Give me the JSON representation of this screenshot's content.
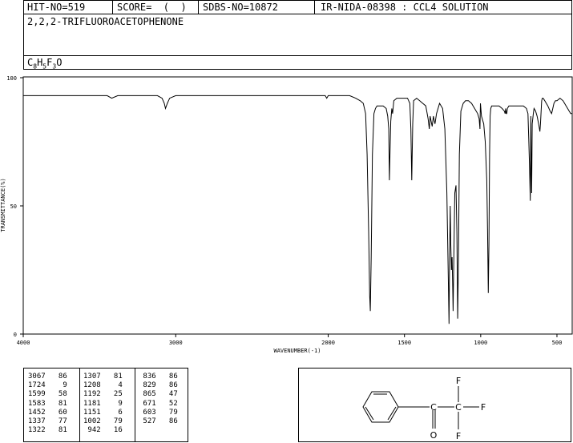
{
  "header": {
    "hit_no": "HIT-NO=519",
    "score": "SCORE=  (  )",
    "sdbs_no": "SDBS-NO=10872",
    "ir_info": "IR-NIDA-08398 : CCL4 SOLUTION",
    "compound_name": "2,2,2-TRIFLUOROACETOPHENONE",
    "formula": {
      "c": "C",
      "c_n": "8",
      "h": "H",
      "h_n": "5",
      "f": "F",
      "f_n": "3",
      "o": "O"
    }
  },
  "chart_data": {
    "type": "line",
    "title": "",
    "xlabel": "WAVENUMBER(-1)",
    "ylabel": "TRANSMITTANCE(%)",
    "xlim": [
      4000,
      400
    ],
    "ylim": [
      0,
      100
    ],
    "x_ticks": [
      {
        "value": 4000,
        "label": "4000"
      },
      {
        "value": 3000,
        "label": "3000"
      },
      {
        "value": 2000,
        "label": "2000"
      },
      {
        "value": 1500,
        "label": "1500"
      },
      {
        "value": 1000,
        "label": "1000"
      },
      {
        "value": 500,
        "label": "500"
      }
    ],
    "y_ticks": [
      {
        "value": 0,
        "label": "0"
      },
      {
        "value": 50,
        "label": "50"
      },
      {
        "value": 100,
        "label": "100"
      }
    ],
    "series": [
      {
        "x": [
          4000,
          3800,
          3600,
          3450,
          3420,
          3380,
          3300,
          3200,
          3120,
          3090,
          3075,
          3067,
          3055,
          3040,
          3000,
          2800,
          2500,
          2200,
          2020,
          2010,
          2000,
          1980,
          1950,
          1900,
          1860,
          1820,
          1790,
          1770,
          1755,
          1745,
          1735,
          1728,
          1724,
          1718,
          1710,
          1700,
          1690,
          1680,
          1660,
          1640,
          1620,
          1610,
          1603,
          1599,
          1595,
          1590,
          1583,
          1578,
          1570,
          1550,
          1530,
          1500,
          1480,
          1465,
          1458,
          1452,
          1446,
          1440,
          1420,
          1400,
          1380,
          1360,
          1345,
          1337,
          1332,
          1322,
          1318,
          1310,
          1307,
          1300,
          1290,
          1270,
          1250,
          1235,
          1222,
          1212,
          1208,
          1204,
          1200,
          1196,
          1192,
          1188,
          1184,
          1181,
          1176,
          1170,
          1162,
          1156,
          1151,
          1146,
          1140,
          1130,
          1115,
          1100,
          1080,
          1060,
          1040,
          1020,
          1010,
          1005,
          1002,
          999,
          995,
          980,
          970,
          960,
          955,
          950,
          946,
          942,
          938,
          934,
          928,
          920,
          900,
          880,
          860,
          845,
          840,
          836,
          832,
          829,
          825,
          815,
          800,
          780,
          760,
          740,
          720,
          700,
          690,
          685,
          680,
          675,
          673,
          671,
          669,
          666,
          662,
          655,
          650,
          640,
          630,
          620,
          612,
          608,
          603,
          600,
          596,
          590,
          580,
          560,
          545,
          535,
          527,
          520,
          510,
          500,
          480,
          460,
          440,
          420,
          410,
          400
        ],
        "values": [
          93,
          93,
          93,
          93,
          92,
          93,
          93,
          93,
          93,
          92,
          90,
          88,
          90,
          92,
          93,
          93,
          93,
          93,
          93,
          92,
          93,
          93,
          93,
          93,
          93,
          92,
          91,
          90,
          86,
          70,
          40,
          15,
          9,
          30,
          70,
          86,
          88,
          89,
          89,
          89,
          88,
          85,
          80,
          60,
          70,
          83,
          88,
          86,
          91,
          92,
          92,
          92,
          92,
          90,
          80,
          60,
          82,
          91,
          92,
          91,
          90,
          89,
          84,
          80,
          85,
          82,
          81,
          85,
          84,
          82,
          86,
          90,
          88,
          80,
          55,
          20,
          4,
          30,
          50,
          35,
          25,
          30,
          20,
          9,
          30,
          55,
          58,
          40,
          6,
          30,
          70,
          87,
          90,
          91,
          91,
          90,
          88,
          86,
          84,
          80,
          90,
          88,
          85,
          82,
          75,
          60,
          40,
          16,
          35,
          70,
          85,
          88,
          89,
          89,
          89,
          89,
          88,
          87,
          86,
          88,
          86,
          86,
          88,
          89,
          89,
          89,
          89,
          89,
          89,
          88,
          86,
          76,
          66,
          52,
          68,
          85,
          70,
          55,
          82,
          86,
          88,
          87,
          85,
          82,
          79,
          82,
          88,
          91,
          92,
          92,
          91,
          89,
          87,
          86,
          88,
          90,
          91,
          91,
          92,
          91,
          89,
          87,
          86,
          86
        ]
      }
    ],
    "peak_table": [
      [
        [
          3067,
          86
        ],
        [
          1724,
          9
        ],
        [
          1599,
          58
        ],
        [
          1583,
          81
        ],
        [
          1452,
          60
        ],
        [
          1337,
          77
        ],
        [
          1322,
          81
        ]
      ],
      [
        [
          1307,
          81
        ],
        [
          1208,
          4
        ],
        [
          1192,
          25
        ],
        [
          1181,
          9
        ],
        [
          1151,
          6
        ],
        [
          1002,
          79
        ],
        [
          942,
          16
        ]
      ],
      [
        [
          836,
          86
        ],
        [
          829,
          86
        ],
        [
          865,
          47
        ],
        [
          671,
          52
        ],
        [
          603,
          79
        ],
        [
          527,
          86
        ]
      ]
    ]
  },
  "structure": {
    "atom_f_top": "F",
    "atom_f_right": "F",
    "atom_f_bottom": "F",
    "atom_c_carbonyl": "C",
    "atom_c_cf3": "C",
    "atom_o": "O"
  }
}
